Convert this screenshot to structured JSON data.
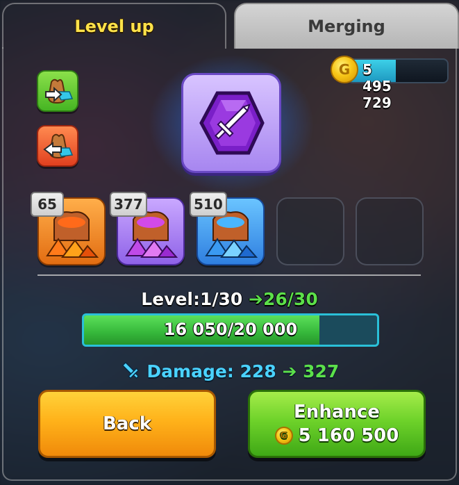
{
  "tabs": [
    {
      "label": "Level up",
      "active": true
    },
    {
      "label": "Merging",
      "active": false
    }
  ],
  "currency": {
    "amount": "5 495 729",
    "icon": "gold-coin-icon"
  },
  "side_buttons": [
    {
      "name": "add-materials",
      "icon": "bag-arrow-in-icon",
      "color": "#46b523"
    },
    {
      "name": "remove-materials",
      "icon": "bag-arrow-out-icon",
      "color": "#e1401f"
    }
  ],
  "main_item": {
    "icon": "purple-sword-gem-icon"
  },
  "material_slots": [
    {
      "count": "65",
      "color": "orange",
      "icon": "orange-crystal-bag-icon"
    },
    {
      "count": "377",
      "color": "purple",
      "icon": "purple-crystal-bag-icon"
    },
    {
      "count": "510",
      "color": "blue",
      "icon": "blue-crystal-bag-icon"
    },
    {
      "count": "",
      "color": "empty"
    },
    {
      "count": "",
      "color": "empty"
    }
  ],
  "level": {
    "label": "Level:",
    "current": "1/30",
    "next": "26/30"
  },
  "progress": {
    "text": "16 050/20 000",
    "current": 16050,
    "max": 20000
  },
  "damage": {
    "label": "Damage:",
    "current": "228",
    "next": "327"
  },
  "buttons": {
    "back": "Back",
    "enhance": "Enhance",
    "enhance_cost": "5 160 500"
  },
  "colors": {
    "accent_gold": "#ffe24a",
    "green": "#5ce04a",
    "cyan": "#4ad2ff"
  }
}
